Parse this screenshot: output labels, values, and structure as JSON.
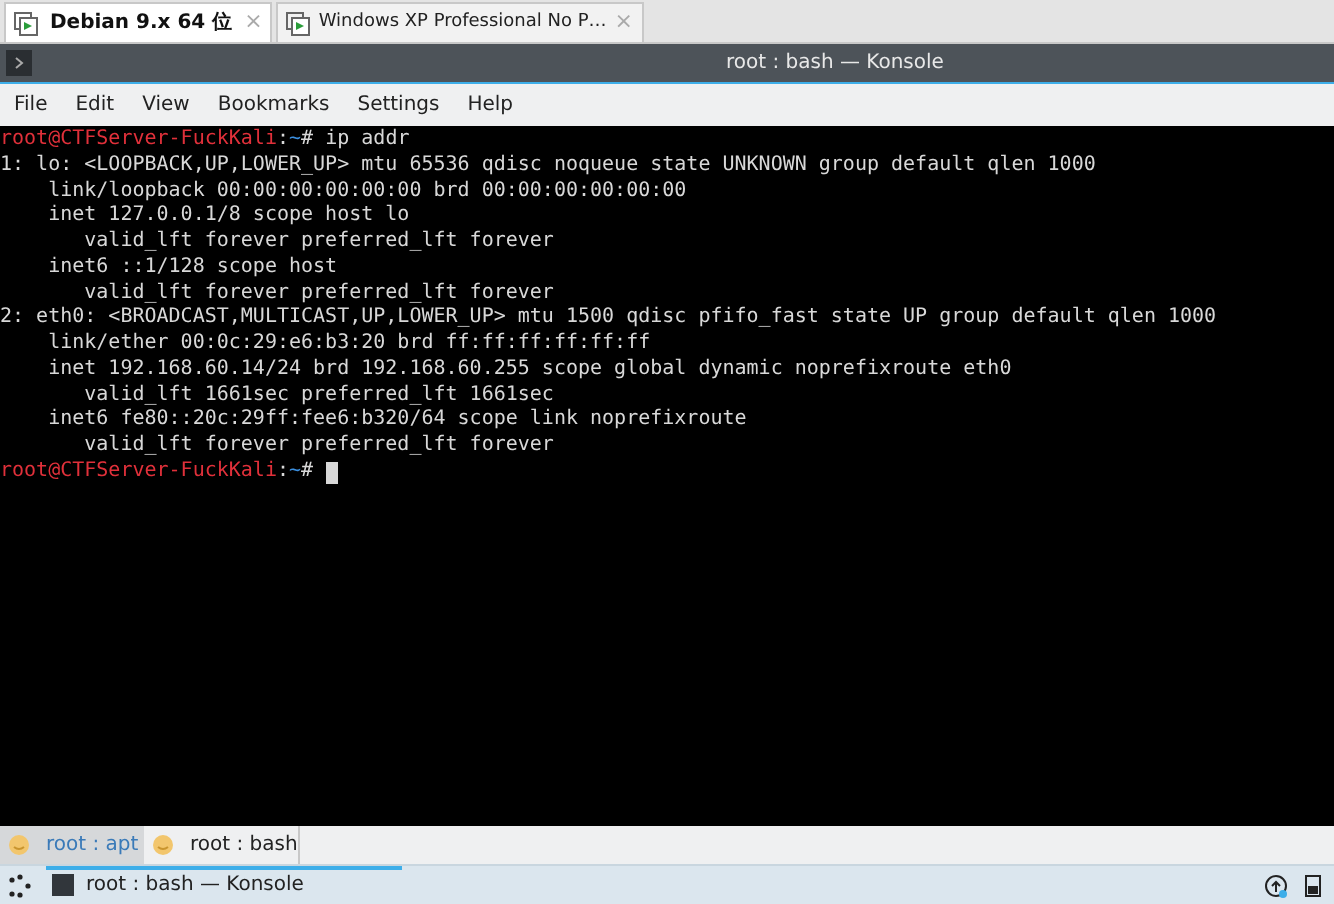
{
  "vm_tabs": [
    {
      "label": "Debian 9.x 64 位",
      "close": "×",
      "selected": true
    },
    {
      "label": "Windows XP Professional No P…",
      "close": "×",
      "selected": false
    }
  ],
  "window": {
    "title": "root : bash — Konsole"
  },
  "menu": [
    "File",
    "Edit",
    "View",
    "Bookmarks",
    "Settings",
    "Help"
  ],
  "terminal": [
    {
      "kind": "prompt",
      "user": "root@CTFServer-FuckKali",
      "sep": ":",
      "path": "~",
      "mark": "# ",
      "command": "ip addr",
      "cursor": false
    },
    {
      "kind": "output",
      "text": "1: lo: <LOOPBACK,UP,LOWER_UP> mtu 65536 qdisc noqueue state UNKNOWN group default qlen 1000"
    },
    {
      "kind": "output",
      "text": "    link/loopback 00:00:00:00:00:00 brd 00:00:00:00:00:00"
    },
    {
      "kind": "output",
      "text": "    inet 127.0.0.1/8 scope host lo"
    },
    {
      "kind": "output",
      "text": "       valid_lft forever preferred_lft forever"
    },
    {
      "kind": "output",
      "text": "    inet6 ::1/128 scope host"
    },
    {
      "kind": "output",
      "text": "       valid_lft forever preferred_lft forever"
    },
    {
      "kind": "output",
      "text": "2: eth0: <BROADCAST,MULTICAST,UP,LOWER_UP> mtu 1500 qdisc pfifo_fast state UP group default qlen 1000"
    },
    {
      "kind": "output",
      "text": "    link/ether 00:0c:29:e6:b3:20 brd ff:ff:ff:ff:ff:ff"
    },
    {
      "kind": "output",
      "text": "    inet 192.168.60.14/24 brd 192.168.60.255 scope global dynamic noprefixroute eth0"
    },
    {
      "kind": "output",
      "text": "       valid_lft 1661sec preferred_lft 1661sec"
    },
    {
      "kind": "output",
      "text": "    inet6 fe80::20c:29ff:fee6:b320/64 scope link noprefixroute"
    },
    {
      "kind": "output",
      "text": "       valid_lft forever preferred_lft forever"
    },
    {
      "kind": "prompt",
      "user": "root@CTFServer-FuckKali",
      "sep": ":",
      "path": "~",
      "mark": "# ",
      "cursor": true
    }
  ],
  "session_tabs": [
    {
      "label": "root : apt",
      "selected": false
    },
    {
      "label": "root : bash",
      "selected": true
    }
  ],
  "taskbar": {
    "task": "root : bash — Konsole"
  }
}
